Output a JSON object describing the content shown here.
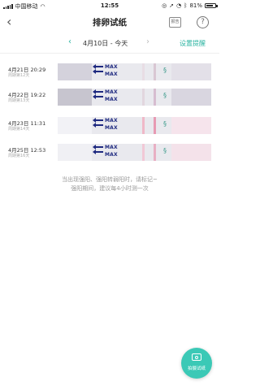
{
  "status_bar": {
    "carrier": "中国移动",
    "time": "12:55",
    "battery": "81%"
  },
  "nav": {
    "title": "排卵试纸",
    "report_label": "报告",
    "help_label": "?"
  },
  "date_bar": {
    "label": "4月10日 - 今天",
    "reminder_link": "设置提醒"
  },
  "records": [
    {
      "date": "4月21日 20:29",
      "cycle": "周期第12天",
      "strip_label": "MAX",
      "test_line_color": "#e8dde4",
      "control_line_color": "#d9c7d3",
      "shade_color": "#d4d2dc",
      "tail_color": "#e3e0e8"
    },
    {
      "date": "4月22日 19:22",
      "cycle": "周期第13天",
      "strip_label": "MAX",
      "test_line_color": "#e2d6de",
      "control_line_color": "#d6bdd0",
      "shade_color": "#c7c5cf",
      "tail_color": "#d9d6e0"
    },
    {
      "date": "4月23日 11:31",
      "cycle": "周期第14天",
      "strip_label": "MAX",
      "test_line_color": "#f0b8c8",
      "control_line_color": "#e79ab3",
      "shade_color": "#f2f2f6",
      "tail_color": "#f6e4ec"
    },
    {
      "date": "4月25日 12:53",
      "cycle": "周期第16天",
      "strip_label": "MAX",
      "test_line_color": "#f1c8d6",
      "control_line_color": "#e8b0c4",
      "shade_color": "#f0f0f4",
      "tail_color": "#f4e2ea"
    }
  ],
  "hint": {
    "line1": "当出现强阳、强阳转弱阳时，请标记~",
    "line2": "强阳期间，建议每4小时测一次"
  },
  "fab": {
    "label": "拍摄试纸"
  }
}
